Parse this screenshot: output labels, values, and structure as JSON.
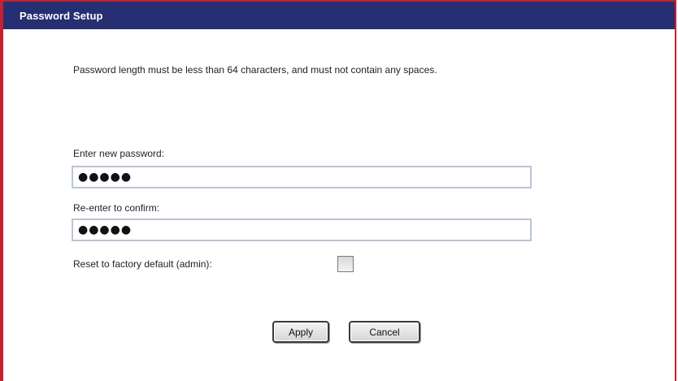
{
  "header": {
    "title": "Password Setup"
  },
  "main": {
    "instructions": "Password length must be less than 64 characters, and must not contain any spaces.",
    "new_password": {
      "label": "Enter new password:",
      "value": "●●●●●"
    },
    "confirm_password": {
      "label": "Re-enter to confirm:",
      "value": "●●●●●"
    },
    "reset_default": {
      "label": "Reset to factory default (admin):",
      "checked": false
    },
    "buttons": {
      "apply_label": "Apply",
      "cancel_label": "Cancel"
    }
  },
  "colors": {
    "title_bar": "#262f72",
    "frame_border": "#c8202c",
    "input_border": "#b9c6d3"
  }
}
